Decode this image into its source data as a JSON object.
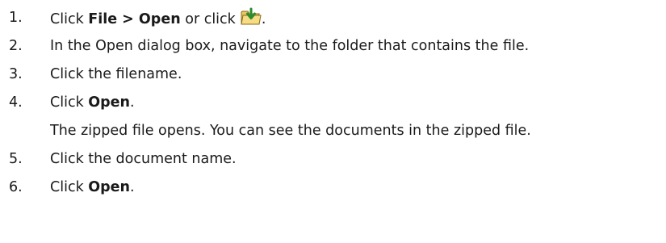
{
  "steps": [
    {
      "number": "1.",
      "pre": "Click ",
      "bold": "File > Open",
      "mid": " or click",
      "icon": "open-folder-icon",
      "post": "."
    },
    {
      "number": "2.",
      "text": "In the Open dialog box, navigate to the folder that contains the file."
    },
    {
      "number": "3.",
      "text": "Click the filename."
    },
    {
      "number": "4.",
      "pre": "Click ",
      "bold": "Open",
      "post": ".",
      "note": "The zipped file opens. You can see the documents in the zipped file."
    },
    {
      "number": "5.",
      "text": "Click the document name."
    },
    {
      "number": "6.",
      "pre": "Click ",
      "bold": "Open",
      "post": "."
    }
  ],
  "colors": {
    "text": "#1a1a1a",
    "folder": "#e8c860",
    "arrow": "#2e8b2e"
  }
}
